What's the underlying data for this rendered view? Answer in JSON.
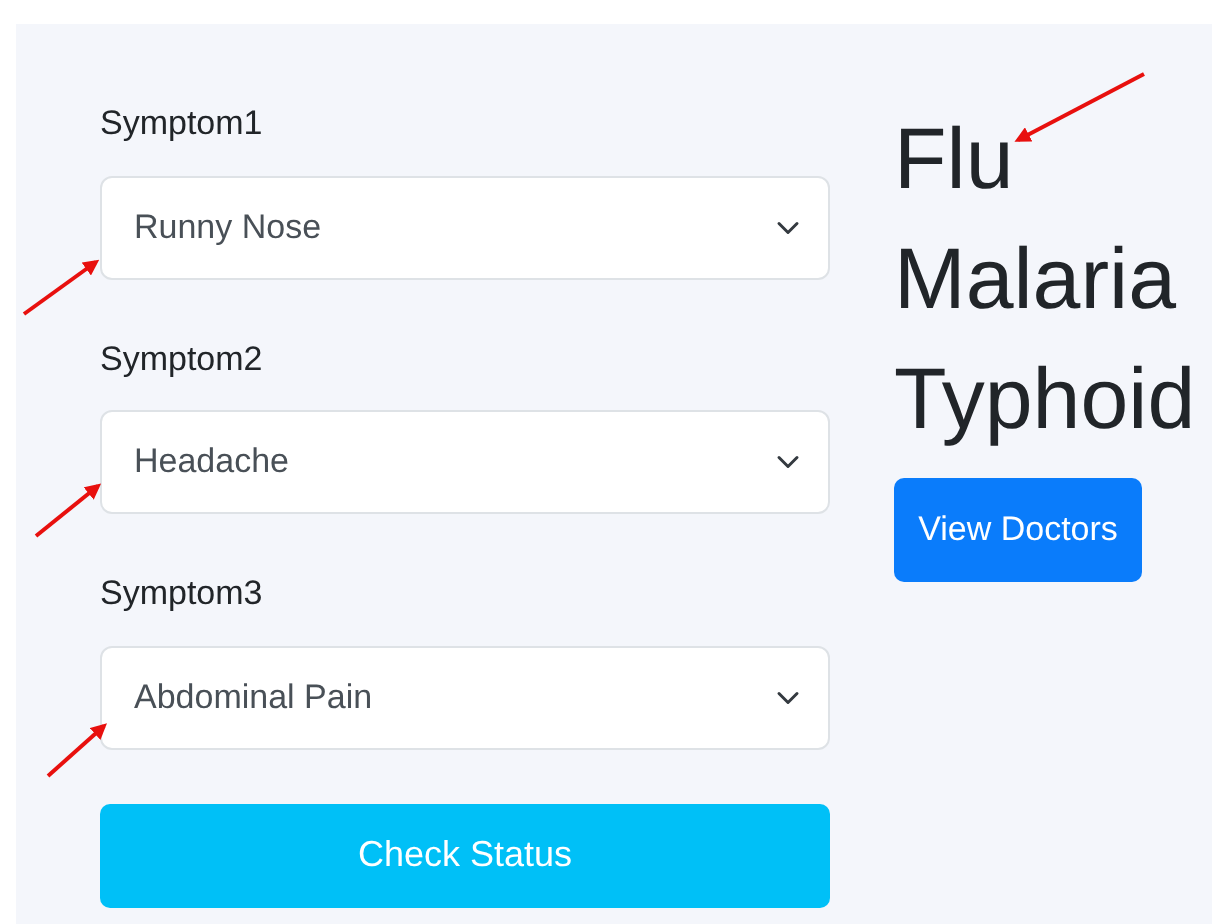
{
  "symptoms": [
    {
      "label": "Symptom1",
      "value": "Runny Nose"
    },
    {
      "label": "Symptom2",
      "value": "Headache"
    },
    {
      "label": "Symptom3",
      "value": "Abdominal Pain"
    }
  ],
  "check_button": "Check Status",
  "diseases": [
    "Flu",
    "Malaria",
    "Typhoid"
  ],
  "doctors_button": "View Doctors"
}
